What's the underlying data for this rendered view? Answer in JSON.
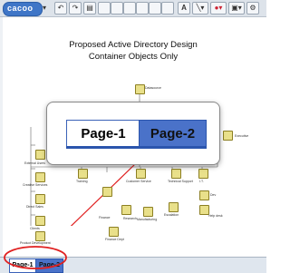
{
  "app": {
    "logo_text": "cacoo"
  },
  "document": {
    "title_line1": "Proposed Active Directory Design",
    "title_line2": "Container Objects Only"
  },
  "diagram": {
    "nodes": [
      {
        "id": "root",
        "label": "Datasource"
      },
      {
        "id": "executive",
        "label": "Executive"
      },
      {
        "id": "external-users",
        "label": "External Users"
      },
      {
        "id": "creative-services",
        "label": "Creative Services"
      },
      {
        "id": "direct-sales",
        "label": "Direct Sales"
      },
      {
        "id": "clients",
        "label": "Clients"
      },
      {
        "id": "product-development",
        "label": "Product Development"
      },
      {
        "id": "training",
        "label": "Training"
      },
      {
        "id": "customer-service",
        "label": "Customer Service"
      },
      {
        "id": "technical-support",
        "label": "Technical Support"
      },
      {
        "id": "it",
        "label": "I.T."
      },
      {
        "id": "finance",
        "label": "Finance"
      },
      {
        "id": "research",
        "label": "Research"
      },
      {
        "id": "manufacturing",
        "label": "Manufacturing"
      },
      {
        "id": "finance-dept",
        "label": "Finance Dept"
      },
      {
        "id": "escalation",
        "label": "Escalation"
      },
      {
        "id": "dev",
        "label": "Dev"
      },
      {
        "id": "help-desk",
        "label": "Help desk"
      }
    ]
  },
  "zoom_callout": {
    "tabs": [
      "Page-1",
      "Page-2"
    ],
    "active_index": 1
  },
  "page_tabs": {
    "tabs": [
      "Page-1",
      "Page-2"
    ],
    "active_index": 1
  },
  "colors": {
    "accent": "#4a72c9",
    "annotation": "#e02020",
    "node_fill": "#e9e08a"
  },
  "toolbar": {
    "icons": [
      "undo-icon",
      "redo-icon",
      "page-icon",
      "blank-icon",
      "blank-icon",
      "blank-icon",
      "blank-icon",
      "blank-icon",
      "blank-icon",
      "text-icon",
      "line-icon",
      "color-icon",
      "format-icon",
      "gear-icon"
    ]
  }
}
